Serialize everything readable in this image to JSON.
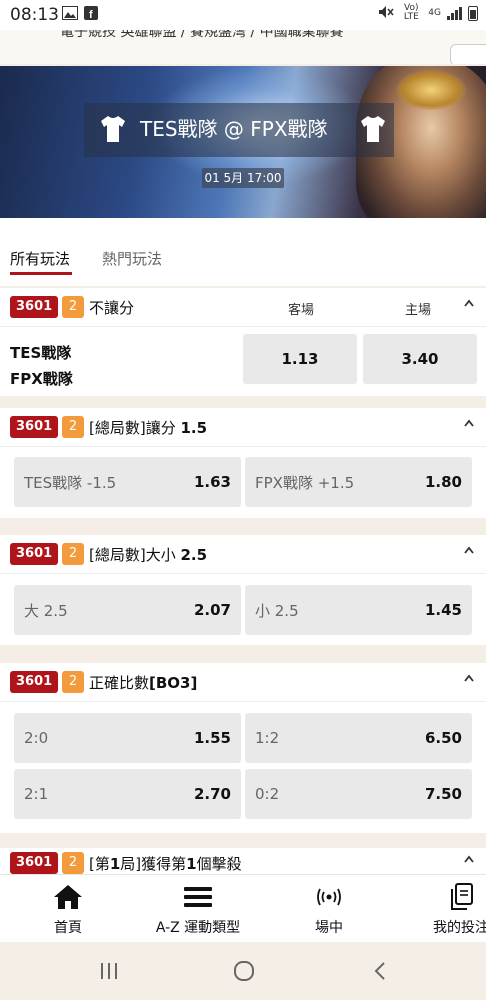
{
  "status_bar": {
    "time": "08:13",
    "network_label": "Vo) LTE",
    "network_4g": "4G"
  },
  "breadcrumb": {
    "text": "電子競技 英雄聯盟 / 賽規盤灣 / 中國職業聯賽"
  },
  "hero": {
    "match_title": "TES戰隊 @ FPX戰隊",
    "datetime": "01 5月 17:00"
  },
  "tabs": [
    {
      "label": "所有玩法",
      "active": true
    },
    {
      "label": "熱門玩法",
      "active": false
    }
  ],
  "markets": [
    {
      "id": "3601",
      "count": "2",
      "title": "不讓分",
      "col_away": "客場",
      "col_home": "主場",
      "team1": "TES戰隊",
      "team2": "FPX戰隊",
      "odds": [
        "1.13",
        "3.40"
      ]
    },
    {
      "id": "3601",
      "count": "2",
      "title_prefix": "[總局數]讓分 ",
      "title_value": "1.5",
      "options": [
        {
          "label": "TES戰隊 -1.5",
          "odd": "1.63"
        },
        {
          "label": "FPX戰隊 +1.5",
          "odd": "1.80"
        }
      ]
    },
    {
      "id": "3601",
      "count": "2",
      "title_prefix": "[總局數]大小 ",
      "title_value": "2.5",
      "options": [
        {
          "label": "大 2.5",
          "odd": "2.07"
        },
        {
          "label": "小 2.5",
          "odd": "1.45"
        }
      ]
    },
    {
      "id": "3601",
      "count": "2",
      "title_prefix": "正確比數",
      "title_value": "[BO3]",
      "options": [
        {
          "label": "2:0",
          "odd": "1.55"
        },
        {
          "label": "1:2",
          "odd": "6.50"
        },
        {
          "label": "2:1",
          "odd": "2.70"
        },
        {
          "label": "0:2",
          "odd": "7.50"
        }
      ]
    },
    {
      "id": "3601",
      "count": "2",
      "title_prefix": "[第",
      "title_value": "1",
      "title_suffix": "局]獲得第",
      "title_value2": "1",
      "title_suffix2": "個擊殺"
    }
  ],
  "bottom_nav": [
    {
      "label": "首頁",
      "icon": "home-icon"
    },
    {
      "label": "A-Z 運動類型",
      "icon": "menu-icon"
    },
    {
      "label": "場中",
      "icon": "live-icon"
    },
    {
      "label": "我的投注",
      "icon": "bets-icon"
    }
  ],
  "colors": {
    "accent": "#b0141b",
    "badge_orange": "#f39a3c",
    "odds_bg": "#e9e9e9"
  }
}
